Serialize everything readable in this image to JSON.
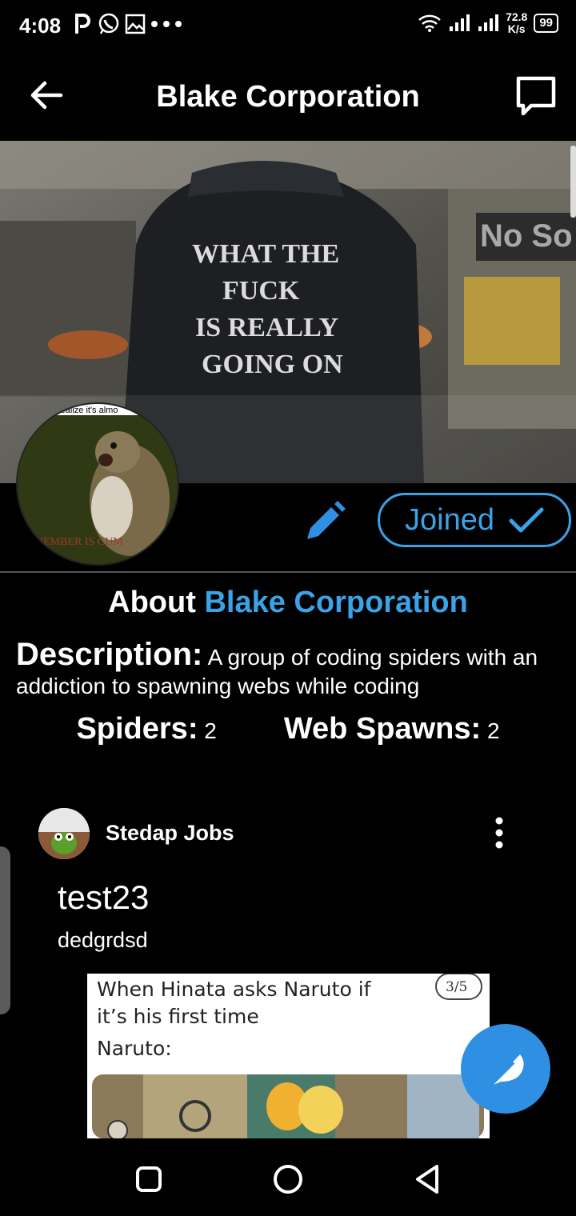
{
  "status": {
    "time": "4:08",
    "net_speed_value": "72.8",
    "net_speed_unit": "K/s",
    "battery": "99"
  },
  "app_bar": {
    "title": "Blake Corporation"
  },
  "banner": {
    "jacket_text": [
      "WHAT THE",
      "FUCK",
      "IS REALLY",
      "GOING ON"
    ],
    "store_sign": "No So"
  },
  "avatar": {
    "top_text": "realize it's almo",
    "bottom_text": "VEMBER IS CUM"
  },
  "actions": {
    "joined_label": "Joined"
  },
  "about": {
    "prefix": "About",
    "name": "Blake Corporation"
  },
  "description": {
    "label": "Description:",
    "text": "A group of coding spiders with an addiction to spawning webs while coding"
  },
  "stats": {
    "spiders_label": "Spiders:",
    "spiders_value": "2",
    "spawns_label": "Web Spawns:",
    "spawns_value": "2"
  },
  "post": {
    "author": "Stedap Jobs",
    "title": "test23",
    "body": "dedgrdsd",
    "image": {
      "caption_line1": "When Hinata asks Naruto if",
      "caption_line2": "it’s his first time",
      "caption_line3": "Naruto:",
      "page_badge": "3/5"
    }
  },
  "icons": {
    "back": "arrow-left-icon",
    "chat": "chat-bubble-icon",
    "edit": "pencil-icon",
    "check": "check-icon",
    "more": "more-vertical-icon",
    "compose": "feather-icon",
    "nav_recents": "square-icon",
    "nav_home": "circle-icon",
    "nav_back": "triangle-back-icon"
  },
  "colors": {
    "accent": "#3aa3e8",
    "fab": "#2f8fe3",
    "background": "#000000"
  }
}
